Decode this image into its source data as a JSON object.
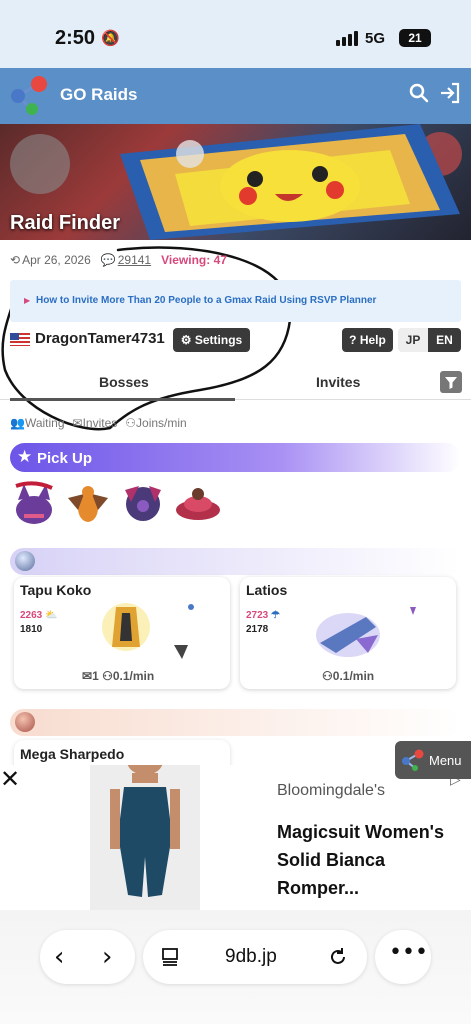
{
  "status": {
    "time": "2:50",
    "network": "5G",
    "battery": "21"
  },
  "header": {
    "title": "GO Raids"
  },
  "banner": {
    "title": "Raid Finder"
  },
  "meta": {
    "date": "Apr 26, 2026",
    "comments": "29141",
    "viewing": "Viewing: 47"
  },
  "notice": {
    "text": "How to Invite More Than 20 People to a Gmax Raid Using RSVP Planner"
  },
  "user": {
    "name": "DragonTamer4731",
    "settings_label": "Settings",
    "help_label": "Help",
    "lang_jp": "JP",
    "lang_en": "EN"
  },
  "tabs": [
    {
      "label": "Bosses"
    },
    {
      "label": "Invites"
    }
  ],
  "legend": {
    "waiting": "Waiting",
    "invites": "Invites",
    "joins": "Joins/min"
  },
  "pickup": {
    "label": "Pick Up"
  },
  "bosses": [
    {
      "name": "Tapu Koko",
      "cp_high": "2263",
      "cp_low": "1810",
      "invites": "1",
      "joins": "0.1/min"
    },
    {
      "name": "Latios",
      "cp_high": "2723",
      "cp_low": "2178",
      "joins": "0.1/min"
    },
    {
      "name": "Mega Sharpedo"
    }
  ],
  "ad": {
    "brand": "Bloomingdale's",
    "headline": "Magicsuit Women's Solid Bianca Romper..."
  },
  "menu": {
    "label": "Menu"
  },
  "browser": {
    "url": "9db.jp"
  },
  "colors": {
    "header": "#5b8fc7",
    "pickup": "#6c55e8",
    "viewing": "#d6497d",
    "link": "#2b6ec2"
  }
}
